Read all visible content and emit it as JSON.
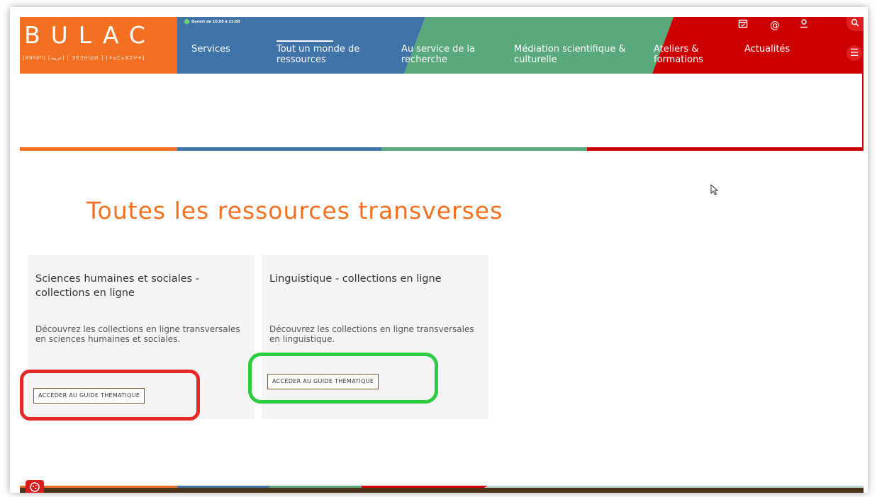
{
  "logo": {
    "text": "BULAC",
    "scripts": "[वसनतग] [عربية] [ ЭЕЗНШИ ] [ⵜⴰⵎⴰⵣⵉⵖⵜ]"
  },
  "header": {
    "opening_hours": "Ouvert de 10:00 à 22:00",
    "nav": [
      {
        "label": "Services"
      },
      {
        "label": "Tout un monde de ressources"
      },
      {
        "label": "Au service de la recherche"
      },
      {
        "label": "Médiation scientifique & culturelle"
      },
      {
        "label": "Ateliers & formations"
      },
      {
        "label": "Actualités"
      }
    ],
    "icons": [
      "calendar-icon",
      "at-icon",
      "user-icon",
      "search-icon",
      "menu-icon"
    ]
  },
  "colors": {
    "orange": "#f36f21",
    "blue": "#4073a8",
    "green": "#5aa97c",
    "red": "#cc0000",
    "card_bg": "#f4f4f4"
  },
  "main": {
    "title": "Toutes les ressources transverses",
    "cards": [
      {
        "title": "Sciences humaines et sociales - collections en ligne",
        "description": "Découvrez les collections en ligne transversales en sciences humaines et sociales.",
        "button": "ACCÉDER AU GUIDE THÉMATIQUE"
      },
      {
        "title": "Linguistique - collections en ligne",
        "description": "Découvrez les collections en ligne transversales en linguistique.",
        "button": "ACCÉDER AU GUIDE THÉMATIQUE"
      }
    ]
  }
}
